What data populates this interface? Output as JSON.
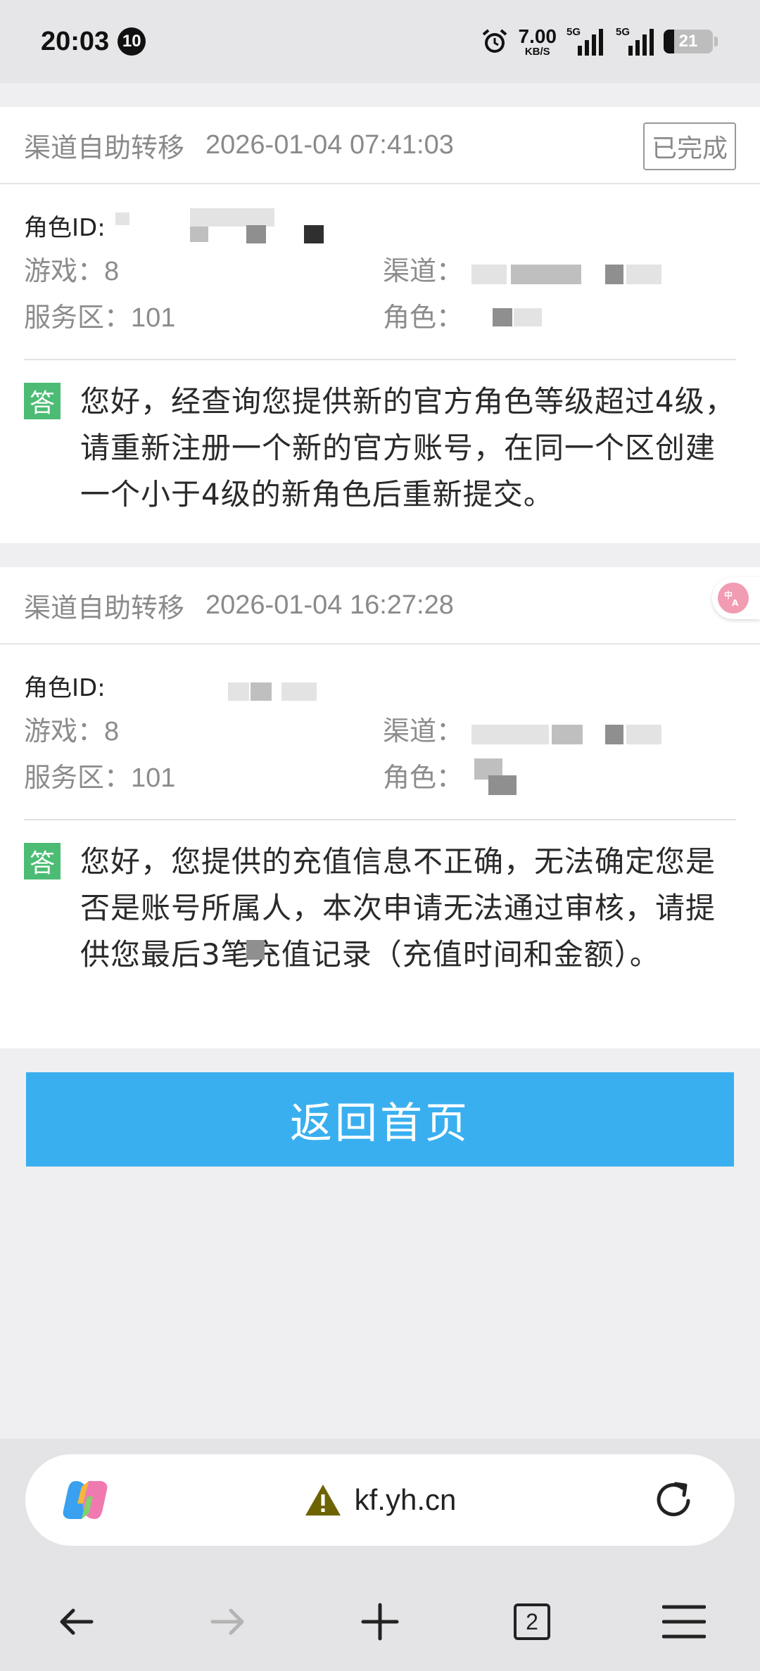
{
  "status_bar": {
    "time": "20:03",
    "notification_count": "10",
    "net_speed": "7.00",
    "net_speed_unit": "KB/S",
    "sim1_label": "5G",
    "sim2_label": "5G",
    "battery": "21",
    "icons": [
      "alarm-icon",
      "signal-icon",
      "battery-icon"
    ]
  },
  "records": [
    {
      "type": "渠道自助转移",
      "time": "2026-01-04 07:41:03",
      "status": "已完成",
      "role_id_label": "角色ID:",
      "game_label": "游戏：",
      "game_value": "8",
      "channel_label": "渠道：",
      "server_label": "服务区：",
      "server_value": "101",
      "role_label": "角色：",
      "answer_tag": "答",
      "answer": "您好，经查询您提供新的官方角色等级超过4级，请重新注册一个新的官方账号，在同一个区创建一个小于4级的新角色后重新提交。"
    },
    {
      "type": "渠道自助转移",
      "time": "2026-01-04 16:27:28",
      "role_id_label": "角色ID:",
      "game_label": "游戏：",
      "game_value": "8",
      "channel_label": "渠道：",
      "server_label": "服务区：",
      "server_value": "101",
      "role_label": "角色：",
      "answer_tag": "答",
      "answer": "您好，您提供的充值信息不正确，无法确定您是否是账号所属人，本次申请无法通过审核，请提供您最后3笔充值记录（充值时间和金额）。"
    }
  ],
  "home_button": "返回首页",
  "browser": {
    "url": "kf.yh.cn",
    "tab_count": "2",
    "icons": [
      "copilot-icon",
      "warning-icon",
      "reload-icon",
      "back-icon",
      "forward-icon",
      "new-tab-icon",
      "tabs-icon",
      "menu-icon"
    ]
  },
  "colors": {
    "accent_button": "#3aaff0",
    "answer_tag": "#4cbc74",
    "page_background": "#efeff1"
  }
}
